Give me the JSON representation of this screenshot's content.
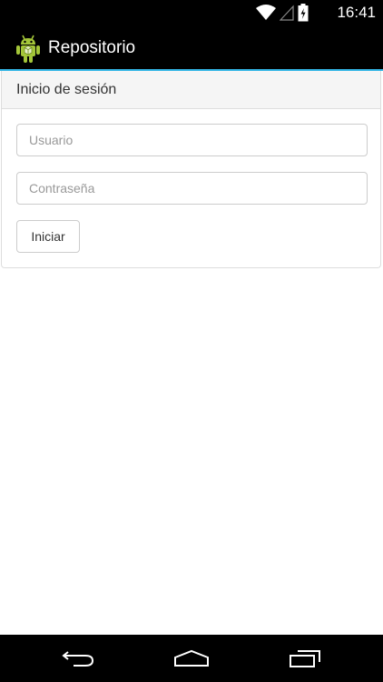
{
  "status_bar": {
    "time": "16:41",
    "icons": [
      "wifi-icon",
      "signal-icon",
      "battery-icon"
    ]
  },
  "action_bar": {
    "title": "Repositorio",
    "icon": "android-app-icon"
  },
  "login_panel": {
    "title": "Inicio de sesión",
    "username": {
      "placeholder": "Usuario",
      "value": ""
    },
    "password": {
      "placeholder": "Contraseña",
      "value": ""
    },
    "submit_label": "Iniciar"
  },
  "nav_bar": {
    "buttons": [
      "back-icon",
      "home-icon",
      "recents-icon"
    ]
  },
  "colors": {
    "accent": "#33b5e5",
    "android_green": "#a4c639",
    "panel_heading_bg": "#f5f5f5",
    "border": "#dddddd"
  }
}
